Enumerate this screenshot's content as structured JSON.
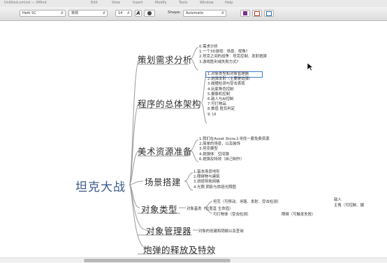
{
  "menu_strip": {
    "items": [
      "Untitled.xmind — XMind",
      "Edit",
      "View",
      "Insert",
      "Modify",
      "Tools",
      "Window",
      "Help"
    ]
  },
  "toolbar": {
    "font_family": "Heiti SC",
    "font_weight": "常规",
    "font_size": "14",
    "italic_glyph": "A",
    "shape_label": "Shape:",
    "shape_value": "Automatic"
  },
  "mindmap": {
    "central": "坦克大战",
    "branches": [
      {
        "title": "策划需求分析",
        "items": [
          "0.需求分析",
          "1.一个3D游戏：场景、视角?",
          "2.坦克之间的战争：坦克控制、发射炮弹",
          "3.游戏胜利或失败方式?"
        ]
      },
      {
        "title": "程序的总体架构",
        "items": [
          "1.对象类型和对象管理器",
          "2.炮弹发射（主要是炮弹）",
          "3.碰撞检测与受击表现",
          "4.玩家角色控制",
          "5.摄像机控制",
          "6.敌人与AI控制",
          "7.可打物品",
          "8.数值 胜负判定",
          "9. UI"
        ]
      },
      {
        "title": "美术资源准备",
        "items": [
          "1.我们在Asset Store上寻找一套免费资源",
          "2.简单的场景，以及装饰",
          "3.坦克模型",
          "4.炮弹体：空间弹",
          "6.炮弹及特效（自己制作）"
        ]
      },
      {
        "title": "场景搭建",
        "items": [
          "1.基本场景地形",
          "2.障碍物与建筑",
          "3.烘焙导航网格",
          "4.光照 阴影与烘焙光照图"
        ]
      },
      {
        "title": "对象类型",
        "base": "对象基类（位置直 生命值）",
        "sub1": "坦克（可移动、寻路、发射、受击检测）",
        "sub1_children": [
          "敌人",
          "主角（可控制、摄"
        ],
        "sub2": "可打物体（受击检测）",
        "sub2_child": "障碍（可触发失败）"
      },
      {
        "title": "对象管理器",
        "note": "对象的创建和销毁以及查询"
      },
      {
        "title": "炮弹的释放及特效"
      }
    ]
  },
  "colors": {
    "selection": "#3a7bd5",
    "tag_purple": "#7b2d8e",
    "tag_red": "#c0392b",
    "tag_blue": "#2f6fb3"
  }
}
